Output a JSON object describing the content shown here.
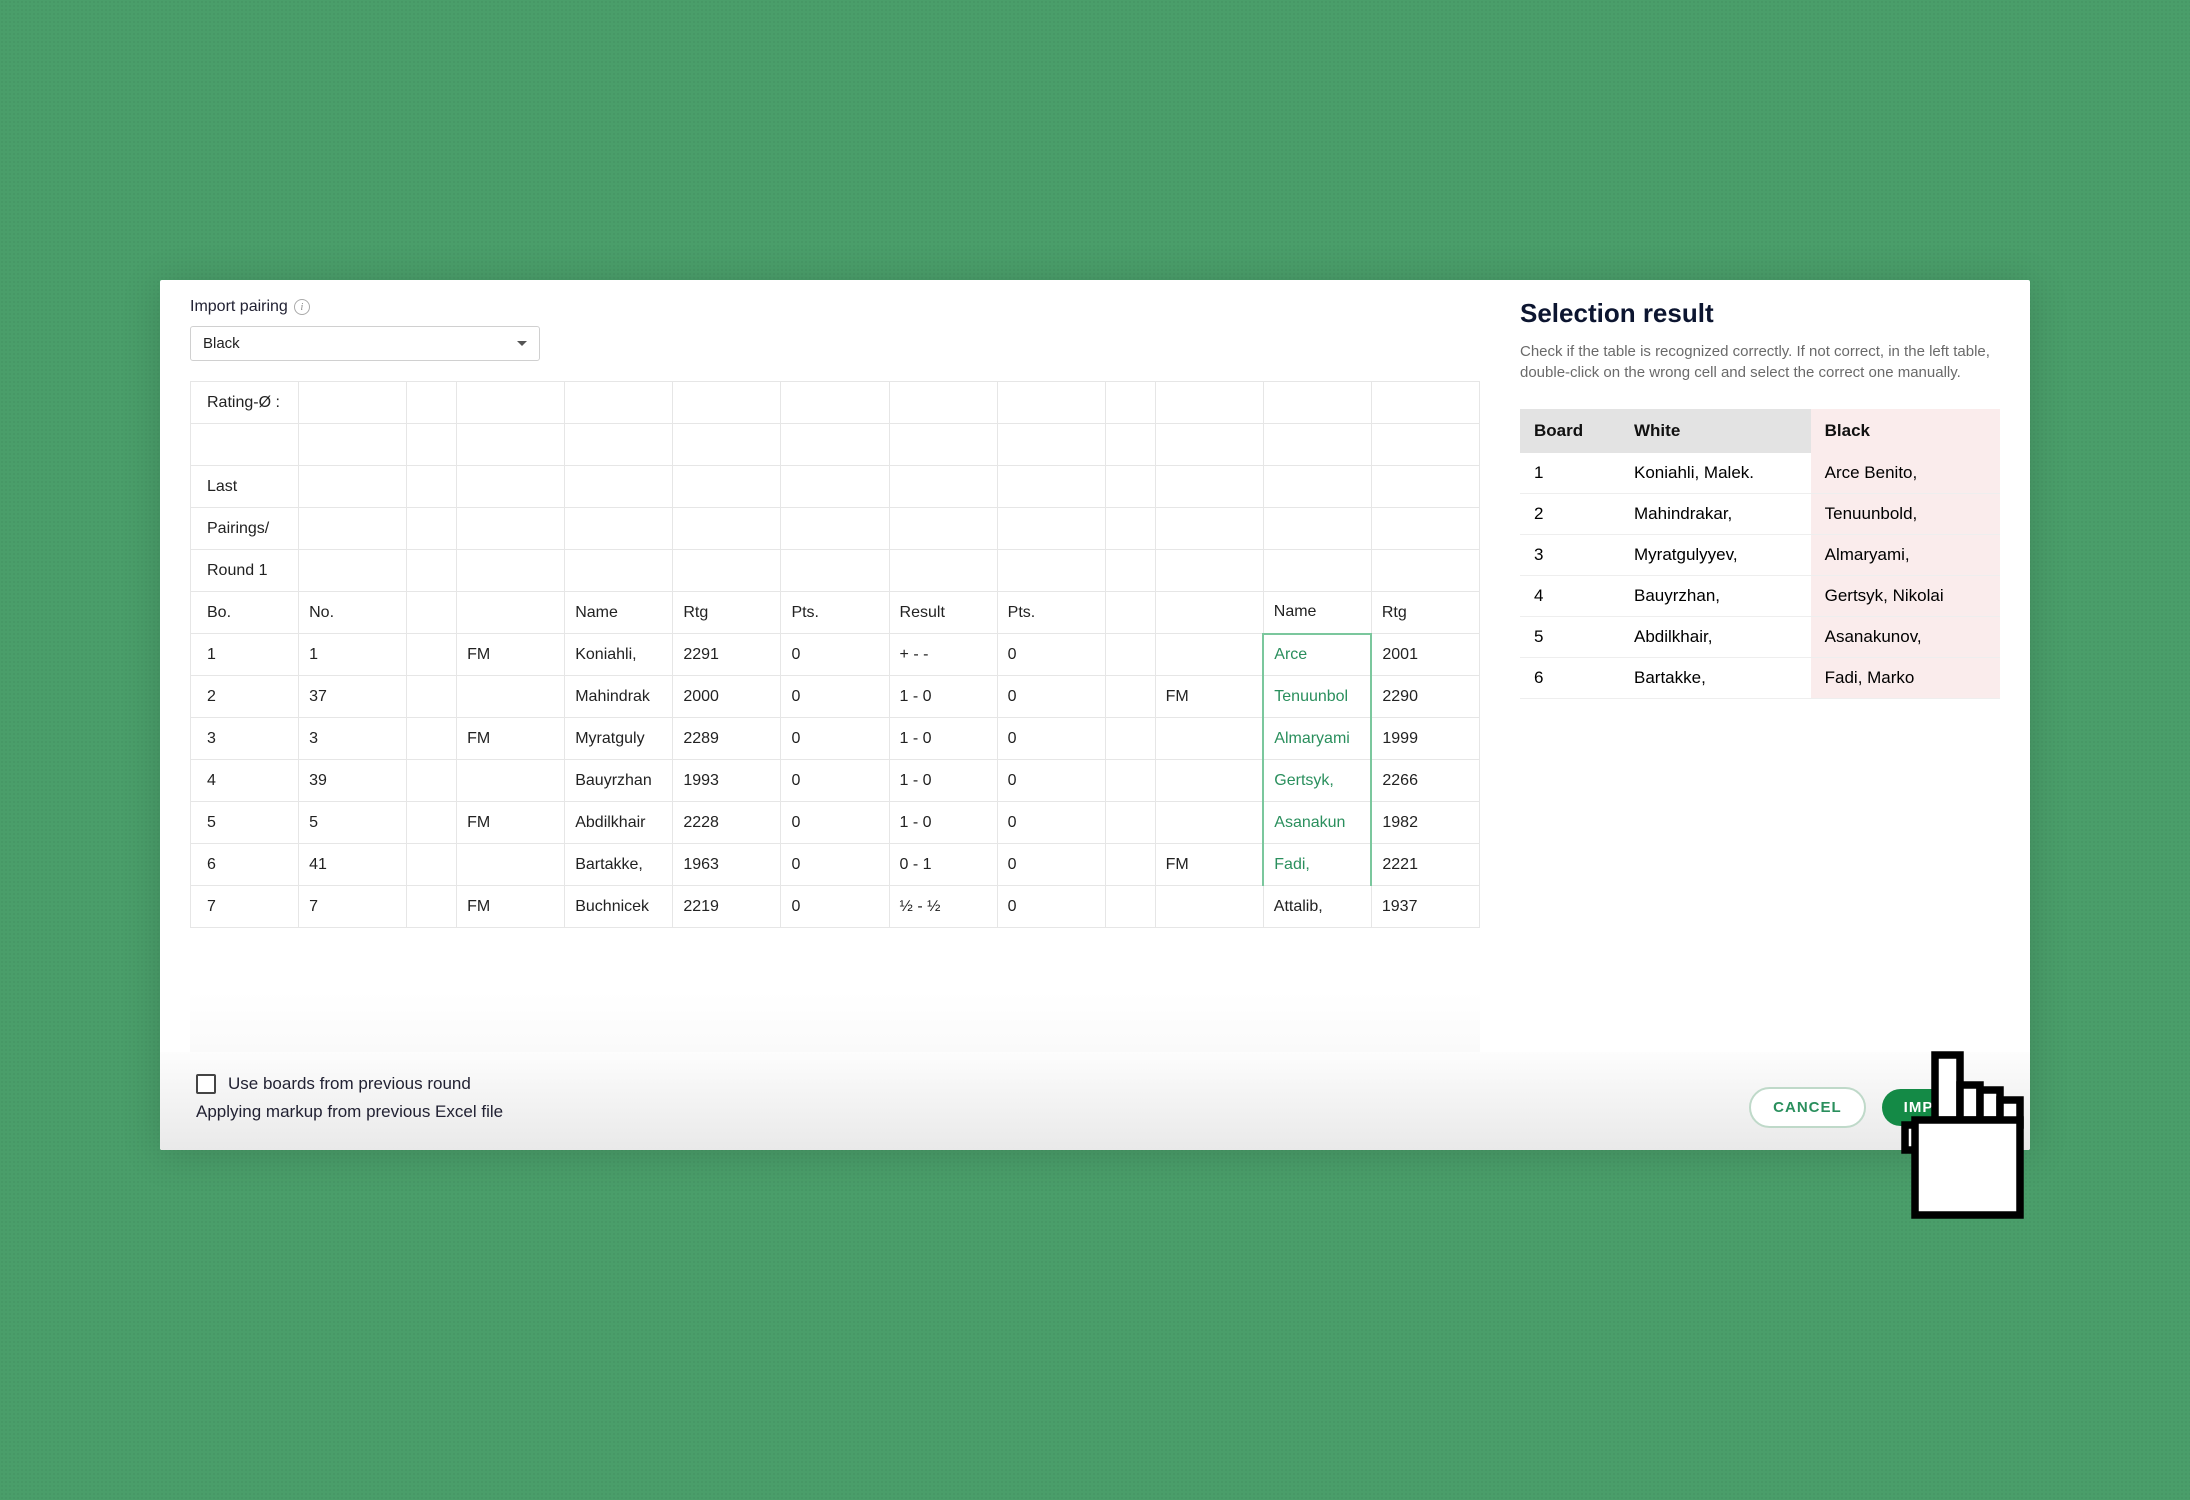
{
  "header": {
    "import_label": "Import pairing",
    "dropdown_value": "Black"
  },
  "grid": {
    "prepend_rows": [
      "Rating-Ø :",
      "",
      "Last",
      "Pairings/",
      "Round 1"
    ],
    "headers": [
      "Bo.",
      "No.",
      "",
      "",
      "Name",
      "Rtg",
      "Pts.",
      "Result",
      "Pts.",
      "",
      "",
      "Name",
      "Rtg"
    ],
    "rows": [
      {
        "bo": "1",
        "no": "1",
        "sp": "",
        "t1": "FM",
        "name1": "Koniahli,",
        "rtg1": "2291",
        "pts1": "0",
        "res": "+ - -",
        "pts2": "0",
        "sp2": "",
        "t2": "",
        "name2": "Arce",
        "rtg2": "2001"
      },
      {
        "bo": "2",
        "no": "37",
        "sp": "",
        "t1": "",
        "name1": "Mahindrak",
        "rtg1": "2000",
        "pts1": "0",
        "res": "1 - 0",
        "pts2": "0",
        "sp2": "",
        "t2": "FM",
        "name2": "Tenuunbol",
        "rtg2": "2290"
      },
      {
        "bo": "3",
        "no": "3",
        "sp": "",
        "t1": "FM",
        "name1": "Myratguly",
        "rtg1": "2289",
        "pts1": "0",
        "res": "1 - 0",
        "pts2": "0",
        "sp2": "",
        "t2": "",
        "name2": "Almaryami",
        "rtg2": "1999"
      },
      {
        "bo": "4",
        "no": "39",
        "sp": "",
        "t1": "",
        "name1": "Bauyrzhan",
        "rtg1": "1993",
        "pts1": "0",
        "res": "1 - 0",
        "pts2": "0",
        "sp2": "",
        "t2": "",
        "name2": "Gertsyk,",
        "rtg2": "2266"
      },
      {
        "bo": "5",
        "no": "5",
        "sp": "",
        "t1": "FM",
        "name1": "Abdilkhair",
        "rtg1": "2228",
        "pts1": "0",
        "res": "1 - 0",
        "pts2": "0",
        "sp2": "",
        "t2": "",
        "name2": "Asanakun",
        "rtg2": "1982"
      },
      {
        "bo": "6",
        "no": "41",
        "sp": "",
        "t1": "",
        "name1": "Bartakke,",
        "rtg1": "1963",
        "pts1": "0",
        "res": "0 - 1",
        "pts2": "0",
        "sp2": "",
        "t2": "FM",
        "name2": "Fadi,",
        "rtg2": "2221"
      },
      {
        "bo": "7",
        "no": "7",
        "sp": "",
        "t1": "FM",
        "name1": "Buchnicek",
        "rtg1": "2219",
        "pts1": "0",
        "res": "½ - ½",
        "pts2": "0",
        "sp2": "",
        "t2": "",
        "name2": "Attalib,",
        "rtg2": "1937"
      }
    ]
  },
  "selection": {
    "title": "Selection result",
    "help": "Check if the table is recognized correctly. If not correct, in the left table, double-click on the wrong cell and select the correct one manually.",
    "columns": [
      "Board",
      "White",
      "Black"
    ],
    "rows": [
      {
        "board": "1",
        "white": "Koniahli, Malek.",
        "black": "Arce Benito,"
      },
      {
        "board": "2",
        "white": "Mahindrakar,",
        "black": "Tenuunbold,"
      },
      {
        "board": "3",
        "white": "Myratgulyyev,",
        "black": "Almaryami,"
      },
      {
        "board": "4",
        "white": "Bauyrzhan,",
        "black": "Gertsyk, Nikolai"
      },
      {
        "board": "5",
        "white": "Abdilkhair,",
        "black": "Asanakunov,"
      },
      {
        "board": "6",
        "white": "Bartakke,",
        "black": "Fadi, Marko"
      }
    ]
  },
  "footer": {
    "checkbox_label": "Use boards from previous round",
    "status": "Applying markup from previous Excel file",
    "cancel": "CANCEL",
    "import": "IMPORT"
  }
}
